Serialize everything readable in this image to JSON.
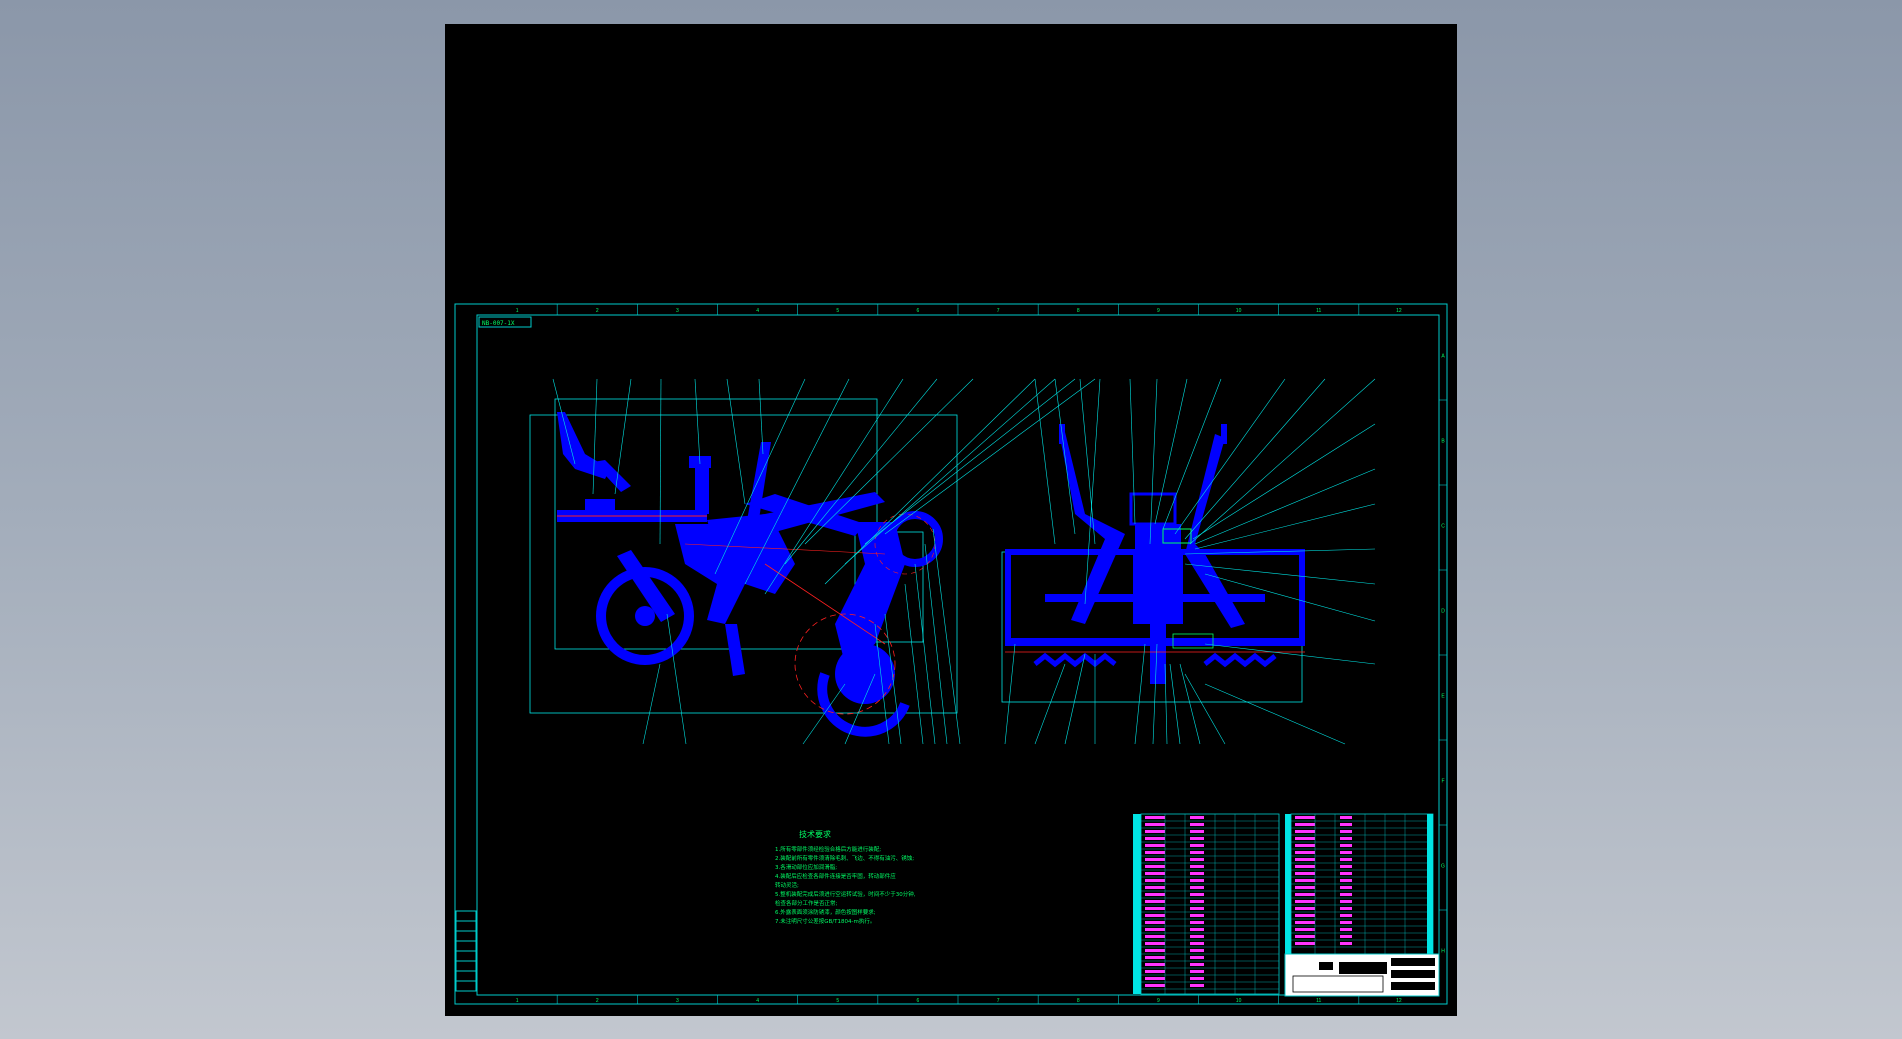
{
  "drawing": {
    "code": "NB-007-1X",
    "col_labels": [
      "1",
      "2",
      "3",
      "4",
      "5",
      "6",
      "7",
      "8",
      "9",
      "10",
      "11",
      "12"
    ],
    "row_labels": [
      "A",
      "B",
      "C",
      "D",
      "E",
      "F",
      "G",
      "H"
    ],
    "tech_title": "技术要求",
    "tech_lines": [
      "1.所有零部件须经检验合格后方能进行装配;",
      "2.装配前所有零件须清除毛刺、飞边、不得有油污、锈蚀;",
      "3.各滑动部位应加润滑脂;",
      "4.装配后应检查各部件连接是否牢固，转动部件应",
      "  转动灵活;",
      "5.整机装配完成后须进行空运转试验，时间不少于30分钟,",
      "  检查各部分工作是否正常;",
      "6.外露表面须涂防锈漆，颜色按图样要求;",
      "7.未注明尺寸公差按GB/T1804-m执行。"
    ]
  },
  "colors": {
    "line": "#00e5e5",
    "part": "#0000ff",
    "text": "#00ff66",
    "table_text": "#ff33ff",
    "frame": "#00cccc",
    "red": "#ff2020"
  }
}
